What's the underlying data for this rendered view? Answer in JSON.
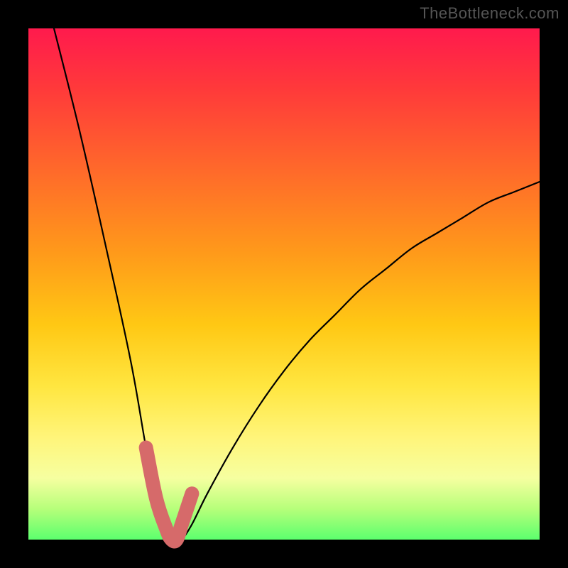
{
  "attribution": "TheBottleneck.com",
  "chart_data": {
    "type": "line",
    "title": "",
    "xlabel": "",
    "ylabel": "",
    "xlim": [
      0,
      100
    ],
    "ylim": [
      0,
      100
    ],
    "series": [
      {
        "name": "bottleneck-curve",
        "x": [
          5,
          10,
          15,
          20,
          23,
          25,
          27,
          28,
          29,
          30,
          32,
          35,
          40,
          45,
          50,
          55,
          60,
          65,
          70,
          75,
          80,
          85,
          90,
          95,
          100
        ],
        "values": [
          100,
          80,
          58,
          35,
          18,
          8,
          2,
          0,
          0,
          0,
          3,
          9,
          18,
          26,
          33,
          39,
          44,
          49,
          53,
          57,
          60,
          63,
          66,
          68,
          70
        ]
      }
    ],
    "highlight": {
      "name": "trough-marker",
      "x": [
        23,
        25,
        27,
        28,
        29,
        30,
        32
      ],
      "values": [
        18,
        8,
        2,
        0,
        0,
        3,
        9
      ],
      "color": "#d66a6a",
      "stroke_width": 20
    }
  }
}
